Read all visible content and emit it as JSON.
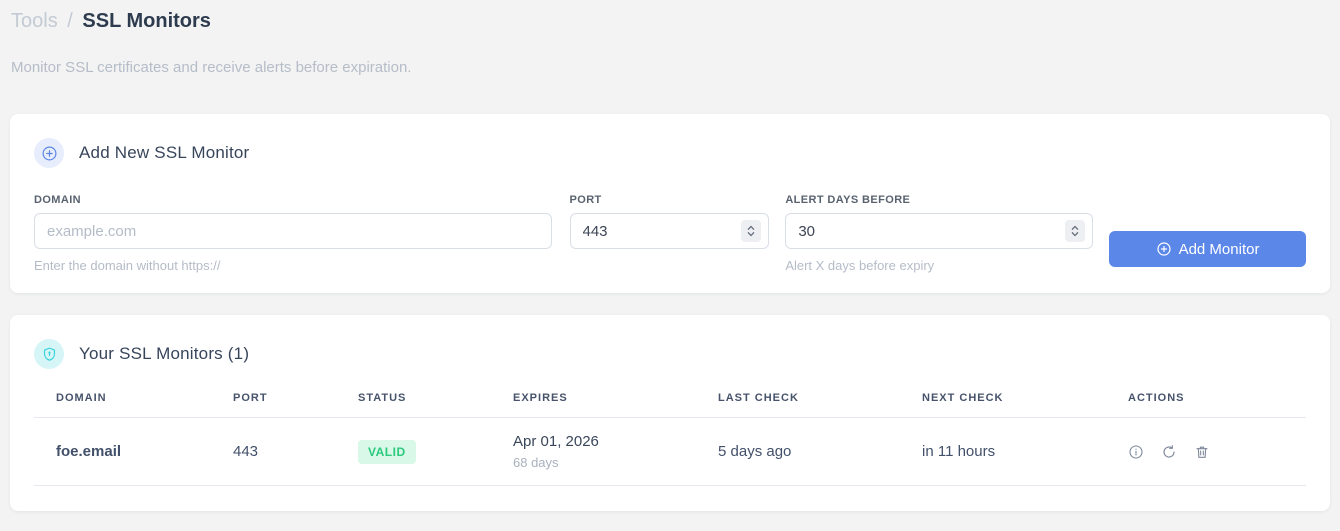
{
  "page": {
    "breadcrumb": {
      "section": "Tools",
      "separator": "/",
      "current": "SSL Monitors"
    },
    "subtitle": "Monitor SSL certificates and receive alerts before expiration."
  },
  "add_monitor": {
    "title": "Add New SSL Monitor",
    "fields": {
      "domain": {
        "label": "DOMAIN",
        "placeholder": "example.com",
        "helper": "Enter the domain without https://"
      },
      "port": {
        "label": "PORT",
        "value": "443"
      },
      "alert_days": {
        "label": "ALERT DAYS BEFORE",
        "value": "30",
        "helper": "Alert X days before expiry"
      }
    },
    "submit_label": "Add Monitor"
  },
  "monitors": {
    "title": "Your SSL Monitors (1)",
    "table": {
      "headers": [
        "DOMAIN",
        "PORT",
        "STATUS",
        "EXPIRES",
        "LAST CHECK",
        "NEXT CHECK",
        "ACTIONS"
      ],
      "rows": [
        {
          "domain": "foe.email",
          "port": "443",
          "status": "VALID",
          "expires_date": "Apr 01, 2026",
          "expires_sub": "68 days",
          "last_check": "5 days ago",
          "next_check": "in 11 hours"
        }
      ]
    }
  },
  "colors": {
    "accent_blue": "#5b87e8",
    "link_blue": "#6b93ed",
    "badge_green_bg": "#d9f8e7",
    "badge_green_text": "#2bc97d",
    "cyan_icon": "#3ad2da",
    "page_bg": "#f2f3f2"
  }
}
